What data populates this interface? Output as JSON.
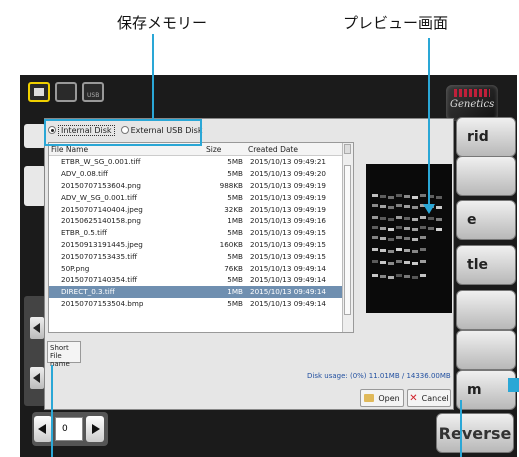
{
  "callouts": {
    "storage_memory": "保存メモリー",
    "preview_screen": "プレビュー画面"
  },
  "dialog": {
    "storage_options": [
      {
        "label": "Internal Disk",
        "selected": true
      },
      {
        "label": "External USB Disk",
        "selected": false
      }
    ],
    "columns": {
      "name": "File Name",
      "size": "Size",
      "date": "Created Date"
    },
    "files": [
      {
        "name": "ETBR_W_SG_0.001.tiff",
        "size": "5MB",
        "date": "2015/10/13 09:49:21"
      },
      {
        "name": "ADV_0.08.tiff",
        "size": "5MB",
        "date": "2015/10/13 09:49:20"
      },
      {
        "name": "20150707153604.png",
        "size": "988KB",
        "date": "2015/10/13 09:49:19"
      },
      {
        "name": "ADV_W_SG_0.001.tiff",
        "size": "5MB",
        "date": "2015/10/13 09:49:19"
      },
      {
        "name": "20150707140404.jpeg",
        "size": "32KB",
        "date": "2015/10/13 09:49:19"
      },
      {
        "name": "20150625140158.png",
        "size": "1MB",
        "date": "2015/10/13 09:49:16"
      },
      {
        "name": "ETBR_0.5.tiff",
        "size": "5MB",
        "date": "2015/10/13 09:49:15"
      },
      {
        "name": "20150913191445.jpeg",
        "size": "160KB",
        "date": "2015/10/13 09:49:15"
      },
      {
        "name": "20150707153435.tiff",
        "size": "5MB",
        "date": "2015/10/13 09:49:15"
      },
      {
        "name": "50P.png",
        "size": "76KB",
        "date": "2015/10/13 09:49:14"
      },
      {
        "name": "20150707140354.tiff",
        "size": "5MB",
        "date": "2015/10/13 09:49:14"
      },
      {
        "name": "DIRECT_0.3.tiff",
        "size": "1MB",
        "date": "2015/10/13 09:49:14",
        "selected": true
      },
      {
        "name": "20150707153504.bmp",
        "size": "5MB",
        "date": "2015/10/13 09:49:14"
      }
    ],
    "short_name_button": "Short File name",
    "disk_usage": "Disk usage: (0%) 11.01MB / 14336.00MB",
    "open_label": "Open",
    "cancel_label": "Cancel"
  },
  "device": {
    "logo_text": "Genetics",
    "side_buttons": [
      "rid",
      "e\ne",
      "e",
      "tle",
      "",
      "",
      "m"
    ],
    "reverse_label": "Reverse",
    "number_value": "0",
    "usb_icon_text": "USB"
  },
  "colors": {
    "callout_line": "#2aa7d6",
    "selected_row": "#6f8fb0",
    "disk_usage_text": "#2250a0"
  }
}
